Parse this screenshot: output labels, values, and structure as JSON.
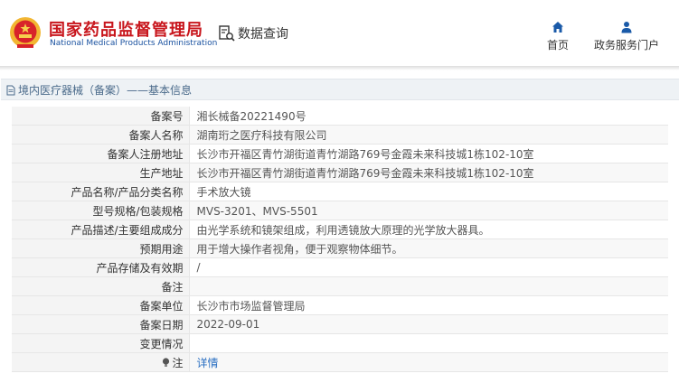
{
  "header": {
    "brand_cn": "国家药品监督管理局",
    "brand_en": "National Medical Products Administration",
    "query_link": "数据查询",
    "nav": [
      {
        "label": "首页",
        "icon": "home-icon"
      },
      {
        "label": "政务服务门户",
        "icon": "user-icon"
      }
    ]
  },
  "section": {
    "title": "境内医疗器械（备案）——基本信息"
  },
  "rows": [
    {
      "label": "备案号",
      "value": "湘长械备20221490号"
    },
    {
      "label": "备案人名称",
      "value": "湖南珩之医疗科技有限公司"
    },
    {
      "label": "备案人注册地址",
      "value": "长沙市开福区青竹湖街道青竹湖路769号金霞未来科技城1栋102-10室"
    },
    {
      "label": "生产地址",
      "value": "长沙市开福区青竹湖街道青竹湖路769号金霞未来科技城1栋102-10室"
    },
    {
      "label": "产品名称/产品分类名称",
      "value": "手术放大镜"
    },
    {
      "label": "型号规格/包装规格",
      "value": "MVS-3201、MVS-5501"
    },
    {
      "label": "产品描述/主要组成成分",
      "value": "由光学系统和镜架组成，利用透镜放大原理的光学放大器具。"
    },
    {
      "label": "预期用途",
      "value": "用于增大操作者视角，便于观察物体细节。"
    },
    {
      "label": "产品存储及有效期",
      "value": "/"
    },
    {
      "label": "备注",
      "value": ""
    },
    {
      "label": "备案单位",
      "value": "长沙市市场监督管理局"
    },
    {
      "label": "备案日期",
      "value": "2022-09-01"
    },
    {
      "label": "变更情况",
      "value": ""
    }
  ],
  "note_row": {
    "label": "注",
    "link": "详情"
  },
  "colors": {
    "brand_red": "#c8161d",
    "brand_blue": "#1a52a0",
    "nav_icon_blue": "#1a5aa8",
    "link_blue": "#2a6fc2"
  }
}
